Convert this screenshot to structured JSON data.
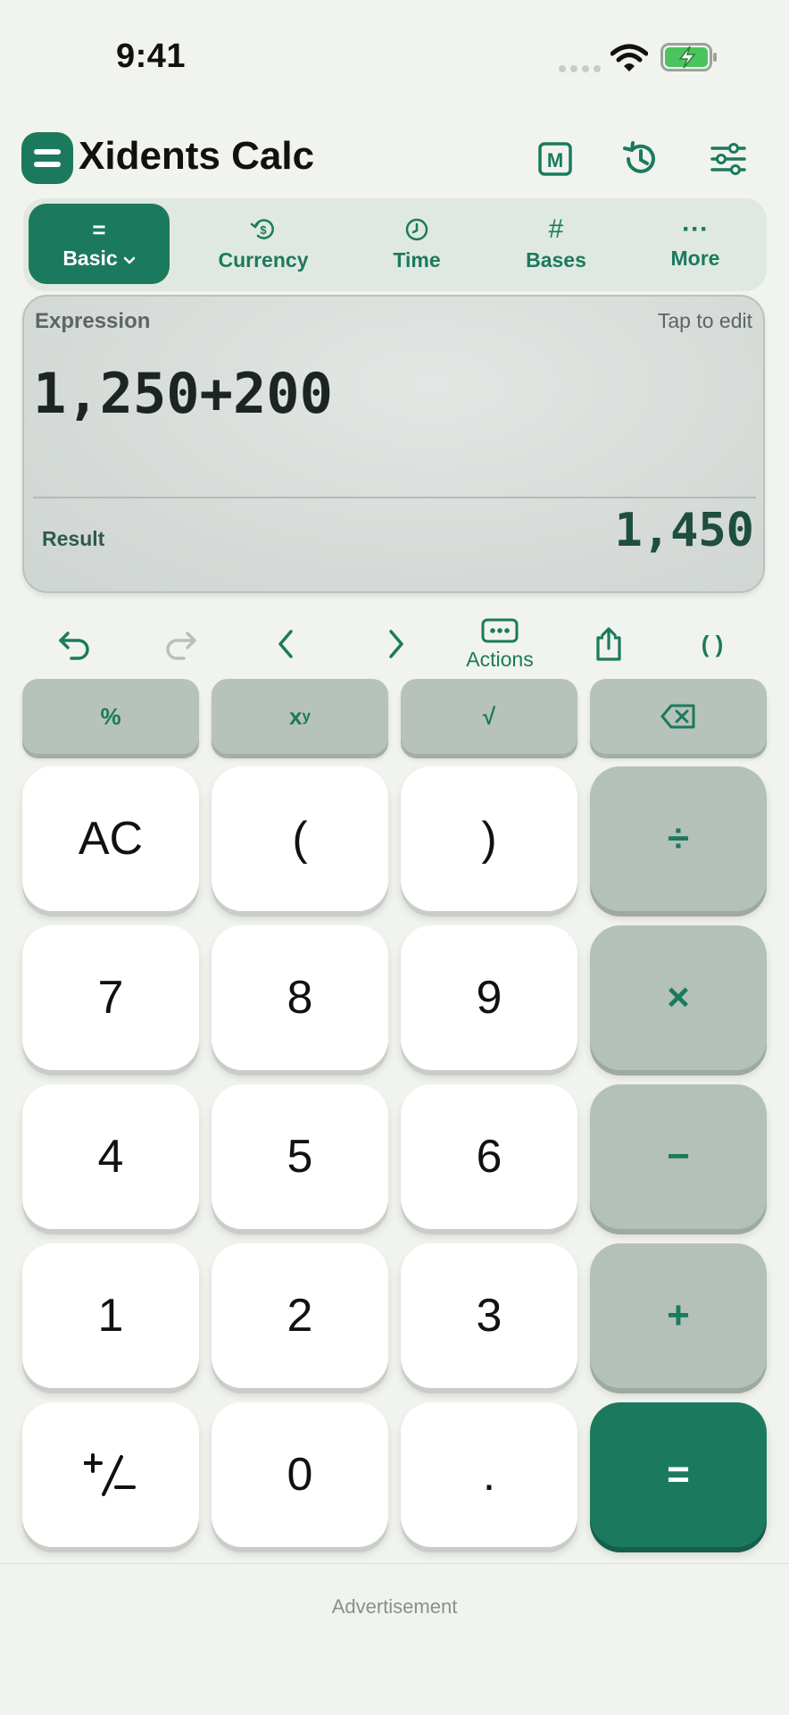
{
  "status_bar": {
    "time": "9:41"
  },
  "header": {
    "title": "Xidents Calc",
    "memory_label": "M"
  },
  "tabs": [
    {
      "label": "Basic",
      "icon": "equals-icon",
      "active": true
    },
    {
      "label": "Currency",
      "icon": "currency-icon",
      "active": false
    },
    {
      "label": "Time",
      "icon": "clock-icon",
      "active": false
    },
    {
      "label": "Bases",
      "icon": "hash-icon",
      "active": false
    },
    {
      "label": "More",
      "icon": "more-icon",
      "active": false
    }
  ],
  "tab_glyphs": {
    "basic": "=",
    "bases": "#",
    "more": "···"
  },
  "display": {
    "expression_label": "Expression",
    "tap_hint": "Tap to edit",
    "expression": "1,250+200",
    "result_label": "Result",
    "result": "1,450"
  },
  "actions": {
    "actions_label": "Actions",
    "parens": "( )"
  },
  "function_keys": {
    "percent": "%",
    "power_base": "x",
    "power_exp": "y",
    "sqrt": "√"
  },
  "keys": {
    "ac": "AC",
    "lparen": "(",
    "rparen": ")",
    "divide": "÷",
    "k7": "7",
    "k8": "8",
    "k9": "9",
    "multiply": "×",
    "k4": "4",
    "k5": "5",
    "k6": "6",
    "minus": "−",
    "k1": "1",
    "k2": "2",
    "k3": "3",
    "plus": "+",
    "k0": "0",
    "dot": ".",
    "equals": "="
  },
  "footer": {
    "ad_label": "Advertisement"
  },
  "colors": {
    "accent": "#1b7a5e",
    "background": "#f1f3ee",
    "operator_key": "#b4c1b8",
    "function_key": "#b6c2ba"
  }
}
